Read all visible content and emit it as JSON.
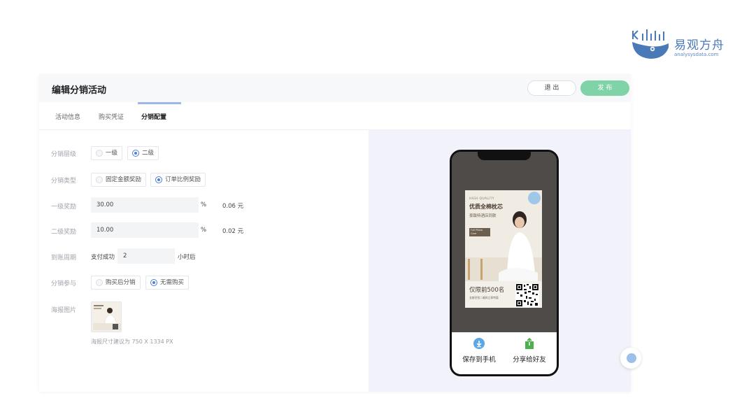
{
  "brand": {
    "name": "易观方舟",
    "url": "analysysdata.com",
    "color": "#4a79b8"
  },
  "header": {
    "title": "编辑分销活动",
    "exit_label": "退 出",
    "publish_label": "发 布"
  },
  "tabs": [
    {
      "label": "活动信息",
      "active": false
    },
    {
      "label": "购买凭证",
      "active": false
    },
    {
      "label": "分销配置",
      "active": true
    }
  ],
  "form": {
    "level": {
      "label": "分销层级",
      "options": [
        "一级",
        "二级"
      ],
      "selected": "二级"
    },
    "type": {
      "label": "分销类型",
      "options": [
        "固定金额奖励",
        "订单比例奖励"
      ],
      "selected": "订单比例奖励"
    },
    "level1": {
      "label": "一级奖励",
      "value": "30.00",
      "unit": "%",
      "result": "0.06 元"
    },
    "level2": {
      "label": "二级奖励",
      "value": "10.00",
      "unit": "%",
      "result": "0.02 元"
    },
    "period": {
      "label": "到账周期",
      "prefix": "支付成功",
      "value": "2",
      "suffix": "小时后"
    },
    "participate": {
      "label": "分销参与",
      "options": [
        "购买后分销",
        "无需购买"
      ],
      "selected": "无需购买"
    },
    "poster": {
      "label": "海报图片",
      "hint": "海报尺寸建议为 750 X 1334 PX"
    }
  },
  "preview": {
    "card": {
      "hq": "HIGH QUALITY",
      "title": "优质全棉枕芯",
      "subtitle": "豪跋特酒店同款",
      "tag": "Full Pillow Core",
      "limit": "仅限前500名",
      "scan": "长按识别二维码立享特惠"
    },
    "actions": {
      "save": "保存到手机",
      "share": "分享给好友"
    }
  },
  "colors": {
    "accent": "#4f7fd6",
    "publish": "#7fd3a6",
    "share_icon": "#4cb14c",
    "save_icon": "#5aa6e6"
  }
}
